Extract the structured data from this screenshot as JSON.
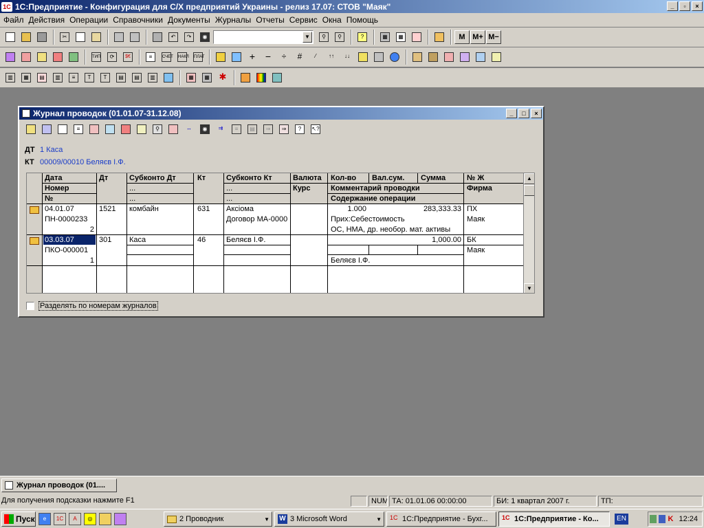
{
  "app_title": "1С:Предприятие - Конфигурация для С/Х предприятий Украины - релиз 17.07: СТОВ \"Маяк\"",
  "menu": [
    "Файл",
    "Действия",
    "Операции",
    "Справочники",
    "Документы",
    "Журналы",
    "Отчеты",
    "Сервис",
    "Окна",
    "Помощь"
  ],
  "memory_buttons": [
    "M",
    "M+",
    "M−"
  ],
  "window": {
    "title": "Журнал проводок (01.01.07-31.12.08)",
    "dt_label": "ДТ",
    "dt_value": "1 Каса",
    "kt_label": "КТ",
    "kt_value": "00009/00010 Беляєв І.Ф."
  },
  "grid": {
    "headers": {
      "data": "Дата",
      "nomer": "Номер",
      "num": "№",
      "dt": "Дт",
      "subkonto_dt": "Субконто Дт",
      "kt": "Кт",
      "subkonto_kt": "Субконто Кт",
      "valuta": "Валюта",
      "kurs": "Курс",
      "kolvo": "Кол-во",
      "valsum": "Вал.сум.",
      "summa": "Сумма",
      "comment": "Комментарий проводки",
      "content": "Содержание операции",
      "nzh": "№ Ж",
      "firma": "Фирма",
      "dots": "..."
    },
    "rows": [
      {
        "date": "04.01.07",
        "number": "ПН-0000233",
        "n": "2",
        "dt": "1521",
        "sub_dt": "комбайн",
        "kt": "631",
        "sub_kt1": "Аксіома",
        "sub_kt2": "Договор МА-0000",
        "kolvo": "1.000",
        "summa": "283,333.33",
        "comment": "Прих:Себестоимость",
        "content": "ОС, НМА, др. необор. мат. активы",
        "nzh": "ПХ",
        "firma": "Маяк"
      },
      {
        "date": "03.03.07",
        "number": "ПКО-000001",
        "n": "1",
        "dt": "301",
        "sub_dt": "Каса",
        "kt": "46",
        "sub_kt1": "Беляєв І.Ф.",
        "summa": "1,000.00",
        "content": "Беляєв І.Ф.",
        "nzh": "БК",
        "firma": "Маяк"
      }
    ]
  },
  "checkbox_label": "Разделять по номерам журналов",
  "mdi_tab": "Журнал проводок (01....",
  "status": {
    "hint": "Для получения подсказки нажмите F1",
    "num": "NUM",
    "ta": "ТА: 01.01.06  00:00:00",
    "bi": "БИ: 1 квартал 2007 г.",
    "tp": "ТП:"
  },
  "taskbar": {
    "start": "Пуск",
    "tasks": [
      "2 Проводник",
      "3 Microsoft Word",
      "1С:Предприятие - Бухг...",
      "1С:Предприятие - Ко..."
    ],
    "lang": "EN",
    "clock": "12:24"
  }
}
